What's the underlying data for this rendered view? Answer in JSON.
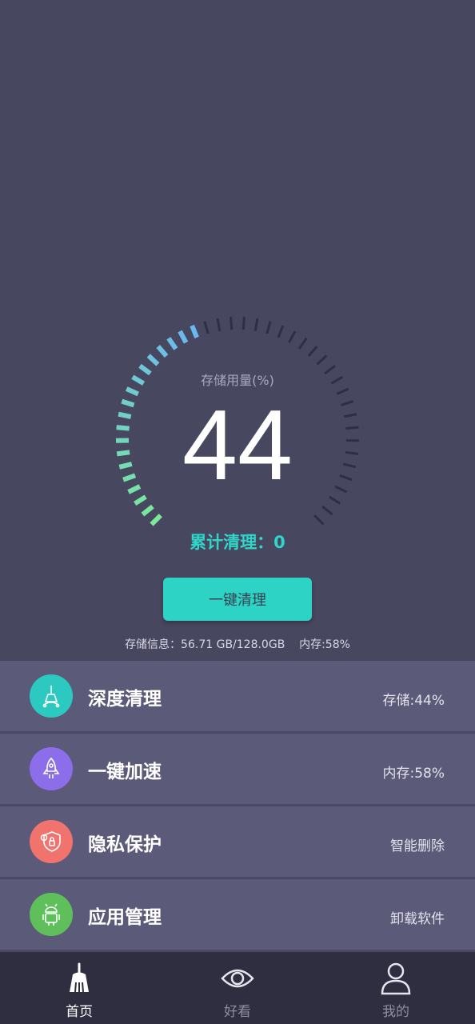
{
  "colors": {
    "background": "#484760",
    "accent": "#2dd4c6",
    "gauge_gradient_start": "#7be89a",
    "gauge_gradient_end": "#6ab7f2",
    "gauge_inactive": "#2f2e42",
    "row_background": "#5b5a78",
    "nav_background": "#2f2e40"
  },
  "gauge": {
    "label": "存储用量(%)",
    "value": "44",
    "fraction": 0.44
  },
  "cleaned": {
    "text": "累计清理：0"
  },
  "clean_button": {
    "label": "一键清理"
  },
  "storage_info": {
    "text": "存储信息：56.71 GB/128.0GB    内存:58%"
  },
  "features": [
    {
      "title": "深度清理",
      "detail": "存储:44%",
      "icon": "broom-icon",
      "color": "#2cc9c0"
    },
    {
      "title": "一键加速",
      "detail": "内存:58%",
      "icon": "rocket-icon",
      "color": "#8c6dea"
    },
    {
      "title": "隐私保护",
      "detail": "智能删除",
      "icon": "shield-icon",
      "color": "#f0736e"
    },
    {
      "title": "应用管理",
      "detail": "卸载软件",
      "icon": "android-icon",
      "color": "#5fbf5a"
    }
  ],
  "nav": {
    "items": [
      {
        "label": "首页",
        "icon": "broom-icon",
        "active": true
      },
      {
        "label": "好看",
        "icon": "eye-icon",
        "active": false
      },
      {
        "label": "我的",
        "icon": "person-icon",
        "active": false
      }
    ],
    "active_color": "#ffffff",
    "inactive_color": "#8e8da3"
  }
}
